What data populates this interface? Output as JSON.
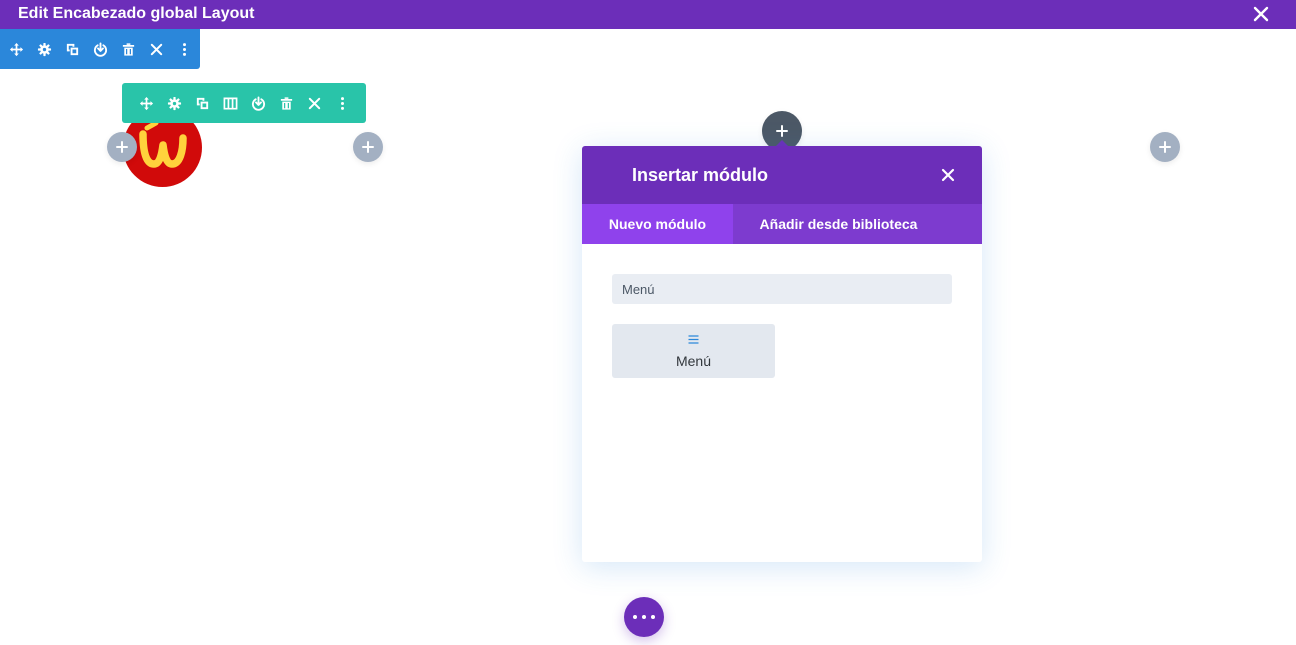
{
  "window": {
    "title": "Edit Encabezado global Layout"
  },
  "section_toolbar": {
    "actions": [
      "move-icon",
      "settings-icon",
      "duplicate-icon",
      "save-to-library-icon",
      "delete-icon",
      "close-icon",
      "more-icon"
    ]
  },
  "row_toolbar": {
    "actions": [
      "move-icon",
      "settings-icon",
      "duplicate-icon",
      "columns-icon",
      "save-to-library-icon",
      "delete-icon",
      "close-icon",
      "more-icon"
    ]
  },
  "logo": {
    "letter": "w"
  },
  "modal": {
    "title": "Insertar módulo",
    "tabs": [
      {
        "label": "Nuevo módulo",
        "active": true
      },
      {
        "label": "Añadir desde biblioteca",
        "active": false
      }
    ],
    "search": {
      "value": "Menú",
      "placeholder": ""
    },
    "results": [
      {
        "label": "Menú",
        "icon": "menu-icon"
      }
    ]
  },
  "colors": {
    "purple": "#6c2eb9",
    "section_blue": "#2b87da",
    "row_green": "#29c4a9",
    "add_gray": "#a3b0c2",
    "logo_red": "#d10a0a",
    "logo_yellow": "#ffd23c"
  }
}
